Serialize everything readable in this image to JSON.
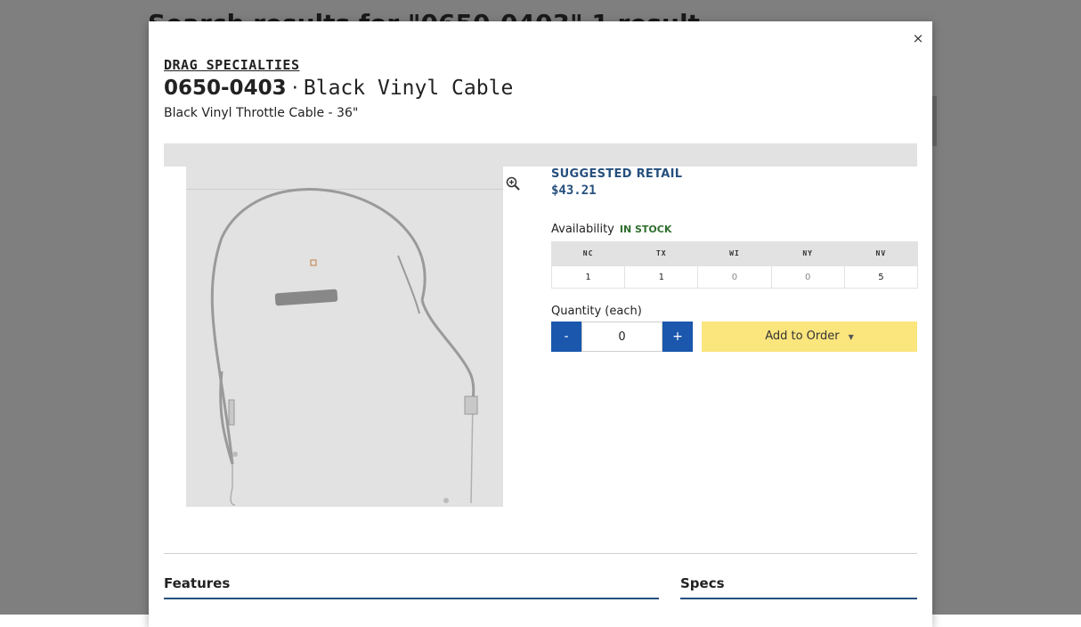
{
  "background": {
    "title": "Search results for \"0650-0403\" 1 result"
  },
  "modal": {
    "close_label": "×",
    "brand": "DRAG SPECIALTIES",
    "part_number": "0650-0403",
    "separator": "·",
    "part_name": "Black Vinyl Cable",
    "subtitle": "Black Vinyl Throttle Cable - 36\"",
    "suggested_retail_label": "SUGGESTED RETAIL",
    "price": "$43.21",
    "availability_label": "Availability",
    "availability_status": "IN STOCK",
    "warehouses": [
      {
        "code": "NC",
        "qty": "1"
      },
      {
        "code": "TX",
        "qty": "1"
      },
      {
        "code": "WI",
        "qty": "0"
      },
      {
        "code": "NY",
        "qty": "0"
      },
      {
        "code": "NV",
        "qty": "5"
      }
    ],
    "quantity_label": "Quantity (each)",
    "minus_label": "-",
    "plus_label": "+",
    "quantity_value": "0",
    "add_to_order_label": "Add to Order",
    "features_heading": "Features",
    "specs_heading": "Specs"
  },
  "colors": {
    "accent_blue": "#26507e",
    "button_blue": "#1a57ad",
    "add_to_order_yellow": "#fbe57d",
    "in_stock_green": "#2f6f2f"
  },
  "icons": {
    "close": "close-icon",
    "zoom": "zoom-in-icon",
    "caret": "chevron-down-icon"
  }
}
